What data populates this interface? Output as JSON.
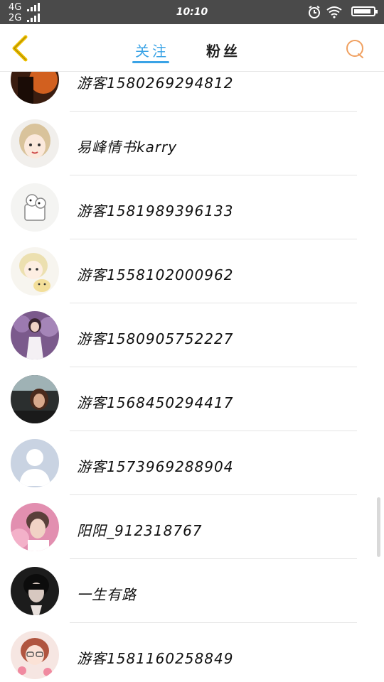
{
  "status_bar": {
    "network_1": "4G",
    "network_2": "2G",
    "time": "10:10",
    "battery_level": 0.9
  },
  "nav": {
    "tab_following": "关注",
    "tab_fans": "粉丝",
    "accent_color": "#3aa3e6",
    "search_color": "#f0a060"
  },
  "contacts": [
    {
      "name": "游客1580269294812",
      "avatar": "dark-warm"
    },
    {
      "name": "易峰情书karry",
      "avatar": "cartoon-girl"
    },
    {
      "name": "游客1581989396133",
      "avatar": "cartoon-bear"
    },
    {
      "name": "游客1558102000962",
      "avatar": "cartoon-boy"
    },
    {
      "name": "游客1580905752227",
      "avatar": "photo-girl-purple"
    },
    {
      "name": "游客1568450294417",
      "avatar": "photo-car"
    },
    {
      "name": "游客1573969288904",
      "avatar": "default-silhouette"
    },
    {
      "name": "阳阳_912318767",
      "avatar": "photo-boy-pink"
    },
    {
      "name": "一生有路",
      "avatar": "photo-dark-boy"
    },
    {
      "name": "游客1581160258849",
      "avatar": "cartoon-glasses-girl"
    }
  ]
}
